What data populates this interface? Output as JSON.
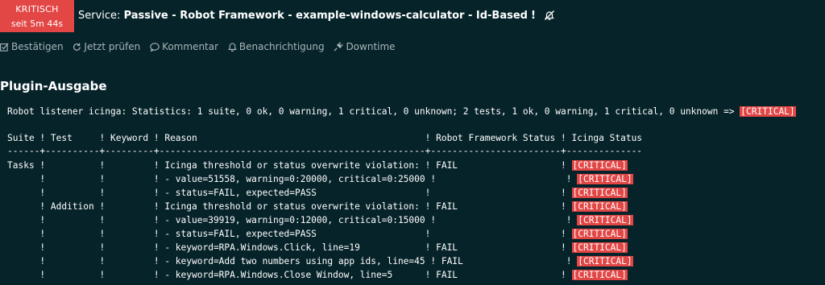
{
  "header": {
    "state_label": "KRITISCH",
    "state_since": "seit 5m 44s",
    "service_prefix": "Service:",
    "service_name": "Passive - Robot Framework - example-windows-calculator - Id-Based",
    "service_flag": "!",
    "state_color": "#e24746"
  },
  "actions": [
    {
      "label": "Bestätigen",
      "icon": "check-square-icon"
    },
    {
      "label": "Jetzt prüfen",
      "icon": "refresh-icon"
    },
    {
      "label": "Kommentar",
      "icon": "comment-icon"
    },
    {
      "label": "Benachrichtigung",
      "icon": "bell-icon"
    },
    {
      "label": "Downtime",
      "icon": "plug-icon"
    }
  ],
  "plugin_output": {
    "title": "Plugin-Ausgabe",
    "summary": "Robot listener icinga: Statistics: 1 suite, 0 ok, 0 warning, 1 critical, 0 unknown; 2 tests, 1 ok, 0 warning, 1 critical, 0 unknown => ",
    "summary_state": "[CRITICAL]",
    "table_header": "Suite ! Test     ! Keyword ! Reason                                          ! Robot Framework Status ! Icinga Status",
    "table_divider": "------+----------+---------+-------------------------------------------------+------------------------+--------------",
    "rows": [
      {
        "text": "Tasks !          !         ! Icinga threshold or status overwrite violation: ! FAIL                   ! ",
        "state": "[CRITICAL]"
      },
      {
        "text": "      !          !         ! - value=51558, warning=0:20000, critical=0:25000 !                        ! ",
        "state": "[CRITICAL]"
      },
      {
        "text": "      !          !         ! - status=FAIL, expected=PASS                    !                        ! ",
        "state": "[CRITICAL]"
      },
      {
        "text": "      ! Addition !         ! Icinga threshold or status overwrite violation: ! FAIL                   ! ",
        "state": "[CRITICAL]"
      },
      {
        "text": "      !          !         ! - value=39919, warning=0:12000, critical=0:15000 !                        ! ",
        "state": "[CRITICAL]"
      },
      {
        "text": "      !          !         ! - status=FAIL, expected=PASS                    !                        ! ",
        "state": "[CRITICAL]"
      },
      {
        "text": "      !          !         ! - keyword=RPA.Windows.Click, line=19            ! FAIL                   ! ",
        "state": "[CRITICAL]"
      },
      {
        "text": "      !          !         ! - keyword=Add two numbers using app ids, line=45 ! FAIL                   ! ",
        "state": "[CRITICAL]"
      },
      {
        "text": "      !          !         ! - keyword=RPA.Windows.Close Window, line=5      ! FAIL                   ! ",
        "state": "[CRITICAL]"
      }
    ]
  }
}
